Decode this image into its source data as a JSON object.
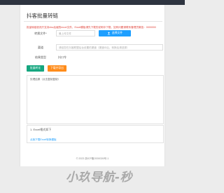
{
  "page": {
    "title": "抖客批量转链",
    "notice": "批量转链依然只支持xlsx后缀的excel文件，Excel模板请先下载的说明中下载，如有问题请联系管理员微信：0000000"
  },
  "form": {
    "file_label": "转换文件*",
    "file_placeholder": "最上传文件",
    "upload_label": "选择文件",
    "channel_label": "渠道",
    "channel_placeholder": "请给您在抖客联盟后台设置的渠道（渠道ID后，转换后请选择）",
    "type_label": "结果类型",
    "type_value": "抖口令"
  },
  "actions": {
    "convert_label": "批量转化",
    "export_label": "下载并导出"
  },
  "result": {
    "placeholder": "处理结果（点击复制复制）"
  },
  "excel_help": {
    "heading": "1. Excel格式如下",
    "link": "点我下载Excel转换模板"
  },
  "footer": {
    "text": "© 2023  浙ICP备2000026号-1"
  },
  "watermark": {
    "text": "小玖导航-秒"
  }
}
